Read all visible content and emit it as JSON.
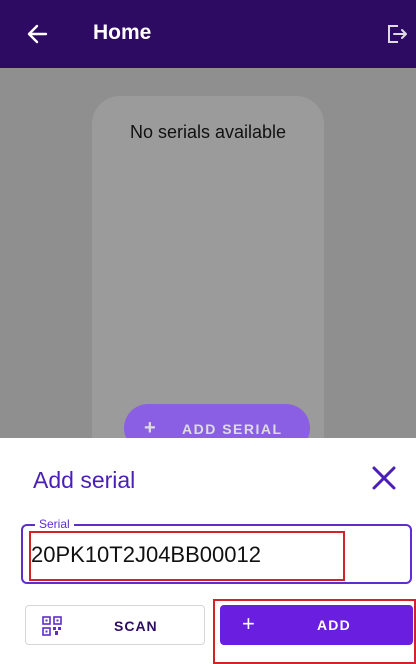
{
  "appbar": {
    "title": "Home",
    "back_icon": "arrow-left-icon",
    "logout_icon": "logout-icon",
    "background": "#2e0b63"
  },
  "home": {
    "empty_message": "No serials available",
    "add_serial_button": "ADD SERIAL"
  },
  "sheet": {
    "title": "Add serial",
    "serial_label": "Serial",
    "serial_value": "20PK10T2J04BB00012",
    "scan_label": "SCAN",
    "add_label": "ADD",
    "accent": "#6a1fe0",
    "title_color": "#4a1fb8"
  }
}
